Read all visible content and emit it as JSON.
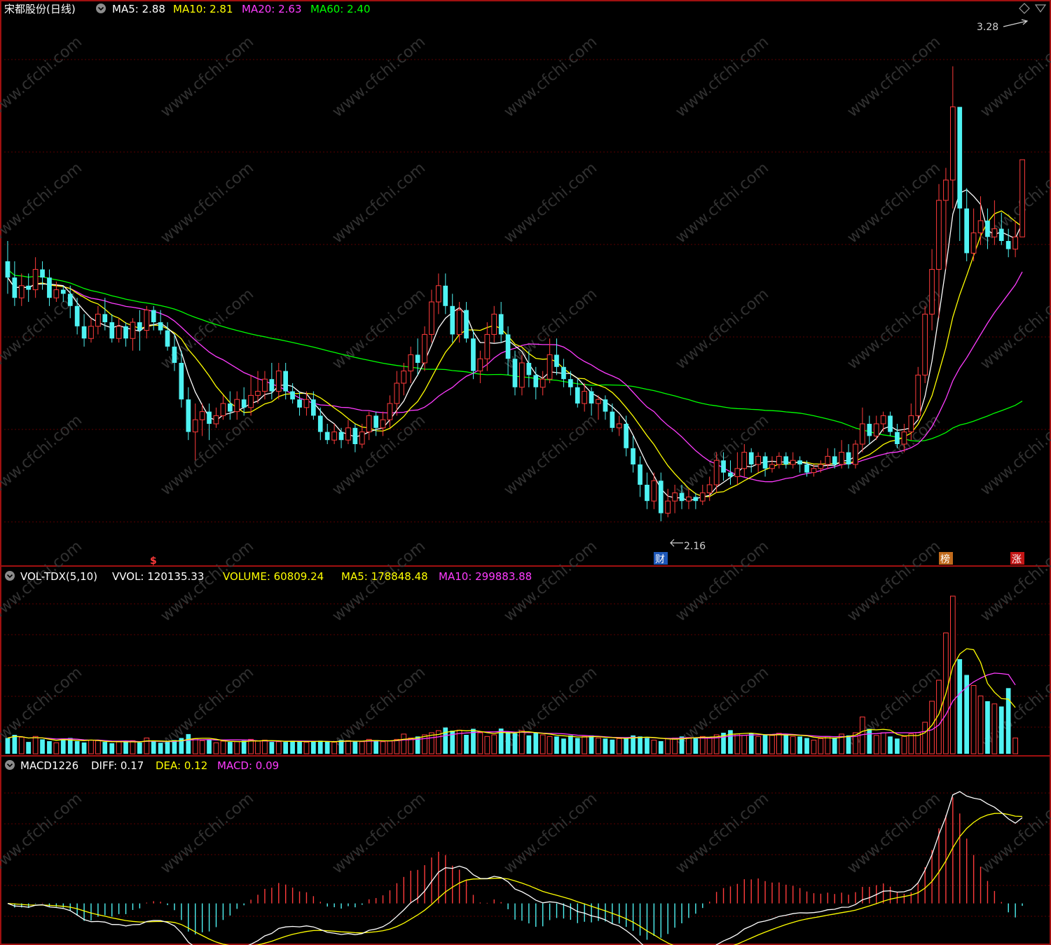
{
  "colors": {
    "background": "#000000",
    "up": "#ff3b3b",
    "down": "#4ff3f3",
    "ma_white": "#ffffff",
    "ma_yellow": "#ffff00",
    "ma_magenta": "#ff3cff",
    "ma_green": "#00ff00",
    "frame": "#a01010",
    "grid": "#5a0000",
    "text_white": "#ffffff",
    "text_gray": "#b8b8b8"
  },
  "header": {
    "title": "宋都股份(日线)",
    "ma5": "MA5: 2.88",
    "ma10": "MA10: 2.81",
    "ma20": "MA20: 2.63",
    "ma60": "MA60: 2.40"
  },
  "price_panel": {
    "high_label": "3.28",
    "low_label": "2.16",
    "markers": [
      {
        "text": "$",
        "color": "#ff3b3b"
      },
      {
        "text": "财",
        "color": "#ffffff"
      },
      {
        "text": "榜",
        "color": "#ffffff"
      },
      {
        "text": "涨",
        "color": "#ffffff"
      }
    ]
  },
  "volume_header": {
    "name": "VOL-TDX(5,10)",
    "vvol": "VVOL: 120135.33",
    "volume": "VOLUME: 60809.24",
    "ma5": "MA5: 178848.48",
    "ma10": "MA10: 299883.88"
  },
  "macd_header": {
    "name": "MACD1226",
    "diff": "DIFF: 0.17",
    "dea": "DEA: 0.12",
    "macd": "MACD: 0.09"
  },
  "watermark": "www.cfchi.com",
  "chart_data": [
    {
      "type": "candlestick",
      "title": "宋都股份(日线)",
      "ylim": [
        2.05,
        3.4
      ],
      "bars": [
        [
          2.8,
          2.76,
          2.85,
          2.72
        ],
        [
          2.76,
          2.71,
          2.8,
          2.69
        ],
        [
          2.71,
          2.74,
          2.77,
          2.69
        ],
        [
          2.74,
          2.73,
          2.77,
          2.7
        ],
        [
          2.73,
          2.78,
          2.81,
          2.71
        ],
        [
          2.78,
          2.76,
          2.8,
          2.73
        ],
        [
          2.76,
          2.71,
          2.78,
          2.69
        ],
        [
          2.71,
          2.73,
          2.75,
          2.7
        ],
        [
          2.73,
          2.72,
          2.74,
          2.7
        ],
        [
          2.72,
          2.69,
          2.74,
          2.66
        ],
        [
          2.69,
          2.64,
          2.71,
          2.62
        ],
        [
          2.64,
          2.61,
          2.67,
          2.59
        ],
        [
          2.61,
          2.64,
          2.66,
          2.6
        ],
        [
          2.64,
          2.67,
          2.69,
          2.62
        ],
        [
          2.67,
          2.65,
          2.71,
          2.63
        ],
        [
          2.65,
          2.61,
          2.67,
          2.6
        ],
        [
          2.61,
          2.64,
          2.66,
          2.6
        ],
        [
          2.64,
          2.61,
          2.65,
          2.59
        ],
        [
          2.61,
          2.65,
          2.66,
          2.58
        ],
        [
          2.65,
          2.63,
          2.68,
          2.58
        ],
        [
          2.63,
          2.68,
          2.69,
          2.61
        ],
        [
          2.68,
          2.65,
          2.69,
          2.63
        ],
        [
          2.65,
          2.63,
          2.68,
          2.62
        ],
        [
          2.63,
          2.59,
          2.65,
          2.58
        ],
        [
          2.59,
          2.55,
          2.62,
          2.53
        ],
        [
          2.55,
          2.46,
          2.58,
          2.44
        ],
        [
          2.46,
          2.38,
          2.49,
          2.36
        ],
        [
          2.38,
          2.41,
          2.45,
          2.31
        ],
        [
          2.41,
          2.43,
          2.45,
          2.37
        ],
        [
          2.43,
          2.4,
          2.45,
          2.36
        ],
        [
          2.4,
          2.42,
          2.44,
          2.39
        ],
        [
          2.42,
          2.45,
          2.47,
          2.41
        ],
        [
          2.45,
          2.43,
          2.48,
          2.41
        ],
        [
          2.43,
          2.46,
          2.48,
          2.41
        ],
        [
          2.46,
          2.44,
          2.49,
          2.42
        ],
        [
          2.44,
          2.47,
          2.52,
          2.42
        ],
        [
          2.47,
          2.48,
          2.53,
          2.45
        ],
        [
          2.48,
          2.51,
          2.53,
          2.46
        ],
        [
          2.51,
          2.48,
          2.55,
          2.46
        ],
        [
          2.48,
          2.53,
          2.55,
          2.46
        ],
        [
          2.53,
          2.48,
          2.55,
          2.46
        ],
        [
          2.48,
          2.46,
          2.5,
          2.45
        ],
        [
          2.46,
          2.44,
          2.48,
          2.42
        ],
        [
          2.44,
          2.46,
          2.48,
          2.42
        ],
        [
          2.46,
          2.42,
          2.48,
          2.41
        ],
        [
          2.42,
          2.38,
          2.44,
          2.36
        ],
        [
          2.38,
          2.36,
          2.4,
          2.35
        ],
        [
          2.36,
          2.38,
          2.4,
          2.35
        ],
        [
          2.38,
          2.36,
          2.39,
          2.34
        ],
        [
          2.36,
          2.39,
          2.41,
          2.35
        ],
        [
          2.39,
          2.35,
          2.4,
          2.33
        ],
        [
          2.35,
          2.38,
          2.4,
          2.34
        ],
        [
          2.38,
          2.42,
          2.43,
          2.36
        ],
        [
          2.42,
          2.39,
          2.43,
          2.37
        ],
        [
          2.39,
          2.41,
          2.43,
          2.37
        ],
        [
          2.41,
          2.45,
          2.47,
          2.39
        ],
        [
          2.45,
          2.5,
          2.53,
          2.42
        ],
        [
          2.5,
          2.53,
          2.55,
          2.47
        ],
        [
          2.53,
          2.57,
          2.59,
          2.5
        ],
        [
          2.57,
          2.55,
          2.61,
          2.52
        ],
        [
          2.55,
          2.62,
          2.64,
          2.53
        ],
        [
          2.62,
          2.7,
          2.73,
          2.6
        ],
        [
          2.7,
          2.74,
          2.77,
          2.67
        ],
        [
          2.74,
          2.69,
          2.77,
          2.67
        ],
        [
          2.69,
          2.62,
          2.72,
          2.6
        ],
        [
          2.62,
          2.68,
          2.7,
          2.6
        ],
        [
          2.68,
          2.61,
          2.7,
          2.6
        ],
        [
          2.61,
          2.53,
          2.63,
          2.51
        ],
        [
          2.53,
          2.56,
          2.58,
          2.5
        ],
        [
          2.56,
          2.62,
          2.65,
          2.53
        ],
        [
          2.62,
          2.67,
          2.69,
          2.6
        ],
        [
          2.67,
          2.62,
          2.7,
          2.6
        ],
        [
          2.62,
          2.56,
          2.64,
          2.52
        ],
        [
          2.56,
          2.49,
          2.58,
          2.47
        ],
        [
          2.49,
          2.55,
          2.57,
          2.47
        ],
        [
          2.55,
          2.52,
          2.58,
          2.49
        ],
        [
          2.52,
          2.49,
          2.54,
          2.46
        ],
        [
          2.49,
          2.51,
          2.53,
          2.47
        ],
        [
          2.51,
          2.57,
          2.61,
          2.5
        ],
        [
          2.57,
          2.54,
          2.61,
          2.52
        ],
        [
          2.54,
          2.51,
          2.56,
          2.49
        ],
        [
          2.51,
          2.49,
          2.53,
          2.47
        ],
        [
          2.49,
          2.45,
          2.51,
          2.44
        ],
        [
          2.45,
          2.48,
          2.5,
          2.43
        ],
        [
          2.48,
          2.45,
          2.49,
          2.42
        ],
        [
          2.45,
          2.46,
          2.47,
          2.41
        ],
        [
          2.46,
          2.43,
          2.47,
          2.41
        ],
        [
          2.43,
          2.39,
          2.45,
          2.38
        ],
        [
          2.39,
          2.4,
          2.42,
          2.37
        ],
        [
          2.4,
          2.34,
          2.42,
          2.32
        ],
        [
          2.34,
          2.3,
          2.37,
          2.28
        ],
        [
          2.3,
          2.25,
          2.32,
          2.22
        ],
        [
          2.25,
          2.21,
          2.28,
          2.19
        ],
        [
          2.21,
          2.26,
          2.28,
          2.19
        ],
        [
          2.26,
          2.18,
          2.28,
          2.16
        ],
        [
          2.18,
          2.21,
          2.24,
          2.17
        ],
        [
          2.21,
          2.23,
          2.25,
          2.18
        ],
        [
          2.23,
          2.21,
          2.25,
          2.19
        ],
        [
          2.21,
          2.22,
          2.24,
          2.19
        ],
        [
          2.22,
          2.21,
          2.23,
          2.19
        ],
        [
          2.21,
          2.23,
          2.25,
          2.2
        ],
        [
          2.23,
          2.25,
          2.27,
          2.21
        ],
        [
          2.25,
          2.31,
          2.33,
          2.23
        ],
        [
          2.31,
          2.28,
          2.33,
          2.26
        ],
        [
          2.28,
          2.27,
          2.31,
          2.25
        ],
        [
          2.27,
          2.29,
          2.33,
          2.25
        ],
        [
          2.29,
          2.33,
          2.35,
          2.27
        ],
        [
          2.33,
          2.3,
          2.34,
          2.28
        ],
        [
          2.3,
          2.32,
          2.33,
          2.28
        ],
        [
          2.32,
          2.29,
          2.33,
          2.27
        ],
        [
          2.29,
          2.3,
          2.32,
          2.28
        ],
        [
          2.3,
          2.32,
          2.33,
          2.29
        ],
        [
          2.32,
          2.3,
          2.33,
          2.29
        ],
        [
          2.3,
          2.31,
          2.33,
          2.29
        ],
        [
          2.31,
          2.3,
          2.32,
          2.28
        ],
        [
          2.3,
          2.28,
          2.31,
          2.27
        ],
        [
          2.28,
          2.29,
          2.3,
          2.27
        ],
        [
          2.29,
          2.3,
          2.31,
          2.28
        ],
        [
          2.3,
          2.32,
          2.34,
          2.29
        ],
        [
          2.32,
          2.3,
          2.34,
          2.29
        ],
        [
          2.3,
          2.33,
          2.36,
          2.29
        ],
        [
          2.33,
          2.3,
          2.35,
          2.29
        ],
        [
          2.3,
          2.35,
          2.36,
          2.29
        ],
        [
          2.35,
          2.4,
          2.44,
          2.33
        ],
        [
          2.4,
          2.37,
          2.42,
          2.35
        ],
        [
          2.37,
          2.4,
          2.42,
          2.36
        ],
        [
          2.4,
          2.42,
          2.43,
          2.38
        ],
        [
          2.42,
          2.38,
          2.43,
          2.37
        ],
        [
          2.38,
          2.35,
          2.4,
          2.34
        ],
        [
          2.35,
          2.38,
          2.4,
          2.33
        ],
        [
          2.38,
          2.42,
          2.45,
          2.36
        ],
        [
          2.42,
          2.52,
          2.54,
          2.41
        ],
        [
          2.52,
          2.67,
          2.69,
          2.5
        ],
        [
          2.67,
          2.78,
          2.83,
          2.63
        ],
        [
          2.78,
          2.95,
          2.99,
          2.66
        ],
        [
          2.95,
          3.0,
          3.03,
          2.78
        ],
        [
          3.0,
          3.18,
          3.28,
          2.93
        ],
        [
          3.18,
          2.93,
          3.08,
          2.85
        ],
        [
          2.93,
          2.82,
          2.98,
          2.8
        ],
        [
          2.82,
          2.87,
          2.93,
          2.8
        ],
        [
          2.87,
          2.9,
          2.96,
          2.84
        ],
        [
          2.9,
          2.86,
          2.93,
          2.83
        ],
        [
          2.86,
          2.88,
          2.95,
          2.84
        ],
        [
          2.88,
          2.85,
          2.92,
          2.84
        ],
        [
          2.85,
          2.83,
          2.88,
          2.81
        ],
        [
          2.83,
          2.86,
          2.9,
          2.81
        ],
        [
          2.86,
          3.05,
          3.05,
          2.86
        ]
      ]
    },
    {
      "type": "bar",
      "name": "VOL-TDX(5,10)",
      "values": [
        60,
        72,
        63,
        45,
        66,
        55,
        48,
        42,
        58,
        60,
        48,
        43,
        52,
        50,
        45,
        40,
        45,
        46,
        50,
        43,
        60,
        48,
        42,
        45,
        52,
        60,
        75,
        58,
        50,
        52,
        42,
        48,
        45,
        46,
        50,
        55,
        48,
        52,
        45,
        46,
        45,
        50,
        48,
        44,
        46,
        50,
        46,
        44,
        52,
        50,
        48,
        46,
        55,
        52,
        46,
        48,
        55,
        75,
        60,
        66,
        72,
        80,
        88,
        100,
        88,
        90,
        72,
        95,
        80,
        66,
        72,
        96,
        85,
        78,
        88,
        70,
        80,
        72,
        66,
        66,
        58,
        70,
        60,
        66,
        70,
        60,
        58,
        54,
        58,
        62,
        70,
        66,
        60,
        52,
        48,
        58,
        60,
        66,
        62,
        60,
        66,
        62,
        72,
        80,
        90,
        75,
        70,
        78,
        66,
        72,
        70,
        78,
        72,
        66,
        66,
        60,
        52,
        58,
        66,
        62,
        75,
        70,
        80,
        140,
        95,
        70,
        80,
        66,
        58,
        66,
        76,
        80,
        120,
        200,
        280,
        460,
        600,
        360,
        300,
        260,
        220,
        200,
        190,
        180,
        250,
        60
      ],
      "ylim": [
        0,
        640
      ]
    },
    {
      "type": "line",
      "name": "MACD1226",
      "series": [
        {
          "name": "DIFF"
        },
        {
          "name": "DEA"
        },
        {
          "name": "MACD"
        }
      ],
      "ylim": [
        -0.06,
        0.2
      ]
    }
  ]
}
